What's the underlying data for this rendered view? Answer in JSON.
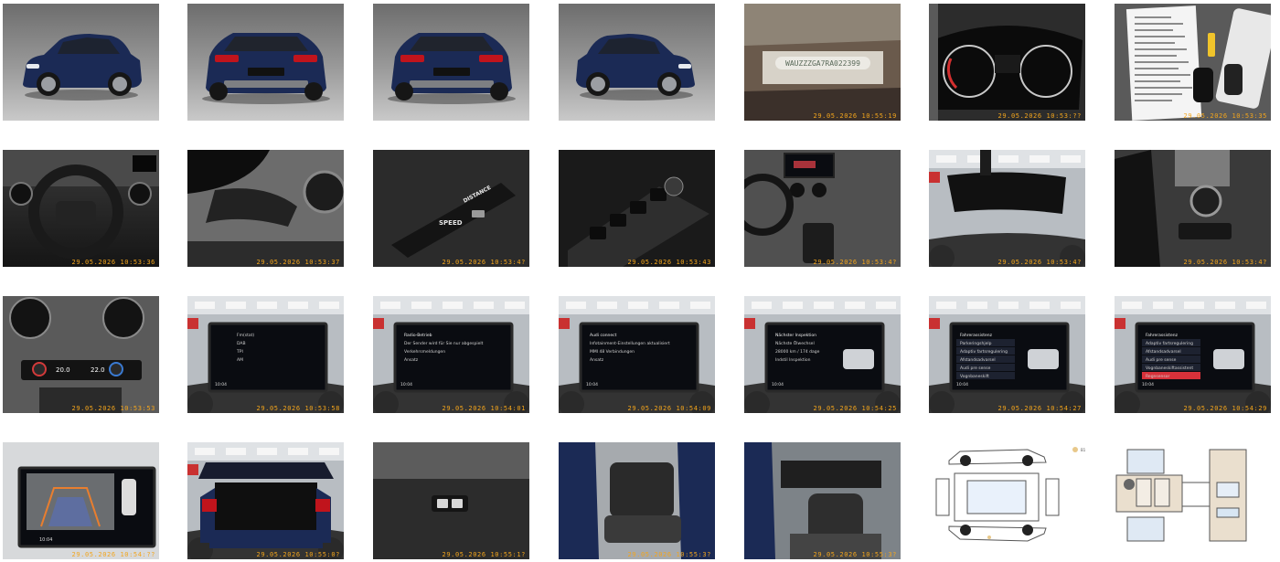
{
  "gallery": {
    "items": [
      {
        "id": "exterior-front-left",
        "stamp": ""
      },
      {
        "id": "exterior-rear-left",
        "stamp": ""
      },
      {
        "id": "exterior-rear-right",
        "stamp": ""
      },
      {
        "id": "exterior-front-right",
        "stamp": ""
      },
      {
        "id": "vin-plate",
        "stamp": "29.05.2026 10:55:19",
        "vin": "WAUZZZGA7RA022399"
      },
      {
        "id": "instrument-cluster",
        "stamp": "29.05.2026 10:53:??"
      },
      {
        "id": "documents-and-keys",
        "stamp": "29.05.2026 10:53:35"
      },
      {
        "id": "steering-wheel",
        "stamp": "29.05.2026 10:53:36"
      },
      {
        "id": "cluster-side",
        "stamp": "29.05.2026 10:53:37"
      },
      {
        "id": "cruise-control-stalk",
        "stamp": "29.05.2026 10:53:4?",
        "labels": [
          "SPEED",
          "DISTANCE"
        ]
      },
      {
        "id": "door-switches",
        "stamp": "29.05.2026 10:53:43"
      },
      {
        "id": "center-console",
        "stamp": "29.05.2026 10:53:4?"
      },
      {
        "id": "rear-mirror",
        "stamp": "29.05.2026 10:53:4?"
      },
      {
        "id": "mmi-controller",
        "stamp": "29.05.2026 10:53:4?"
      },
      {
        "id": "climate-panel",
        "stamp": "29.05.2026 10:53:53",
        "temps": [
          "20.0",
          "22.0"
        ]
      },
      {
        "id": "mmi-home",
        "stamp": "29.05.2026 10:53:58",
        "time": "10:04"
      },
      {
        "id": "mmi-radio",
        "stamp": "29.05.2026 10:54:01",
        "time": "10:04"
      },
      {
        "id": "mmi-message",
        "stamp": "29.05.2026 10:54:09",
        "time": "10:04"
      },
      {
        "id": "mmi-service",
        "stamp": "29.05.2026 10:54:25",
        "time": "10:04"
      },
      {
        "id": "mmi-assist-1",
        "stamp": "29.05.2026 10:54:27",
        "time": "10:04"
      },
      {
        "id": "mmi-assist-2",
        "stamp": "29.05.2026 10:54:29",
        "time": "10:04"
      },
      {
        "id": "rear-camera",
        "stamp": "29.05.2026 10:54:??",
        "time": "10:04"
      },
      {
        "id": "trunk-open",
        "stamp": "29.05.2026 10:55:0?"
      },
      {
        "id": "trunk-switch",
        "stamp": "29.05.2026 10:55:1?"
      },
      {
        "id": "rear-seats",
        "stamp": "29.05.2026 10:55:3?"
      },
      {
        "id": "front-seats",
        "stamp": "29.05.2026 10:55:3?"
      },
      {
        "id": "damage-diagram-exterior",
        "stamp": "",
        "legend": "B1"
      },
      {
        "id": "damage-diagram-interior",
        "stamp": ""
      }
    ]
  },
  "screens": {
    "home": [
      "Fm(stat)",
      "DAB",
      "TPI",
      "AM"
    ],
    "radio": [
      "Radio-Betrieb",
      "Der Sender wird für Sie nur abgespielt",
      "Verkehrsmeldungen",
      "Ansatz"
    ],
    "message": [
      "Audi connect",
      "Infotainment-Einstellungen aktualisiert",
      "MMI 48 Verbindungen",
      "Ansatz"
    ],
    "service": [
      "Nächster Inspektion",
      "Nächste Ölwechsel",
      "28000 km / 174 dage",
      "Indstil Inspektion"
    ],
    "assist1": [
      "Fahrerassistenz",
      "Parkeringshjelp",
      "Adaptiv fartsregulering",
      "Afstandsadvarsel",
      "Audi pre sense",
      "Vognbaneskift"
    ],
    "assist2": [
      "Fahrerassistenz",
      "Adaptiv fartsregulering",
      "Afstandsadvarsel",
      "Audi pre sense",
      "Vognbaneskiftassistent",
      "Regnsensor"
    ]
  },
  "colors": {
    "stamp": "#f3a51c",
    "car_blue": "#1b2a55",
    "mmi_accent": "#d7313a"
  }
}
